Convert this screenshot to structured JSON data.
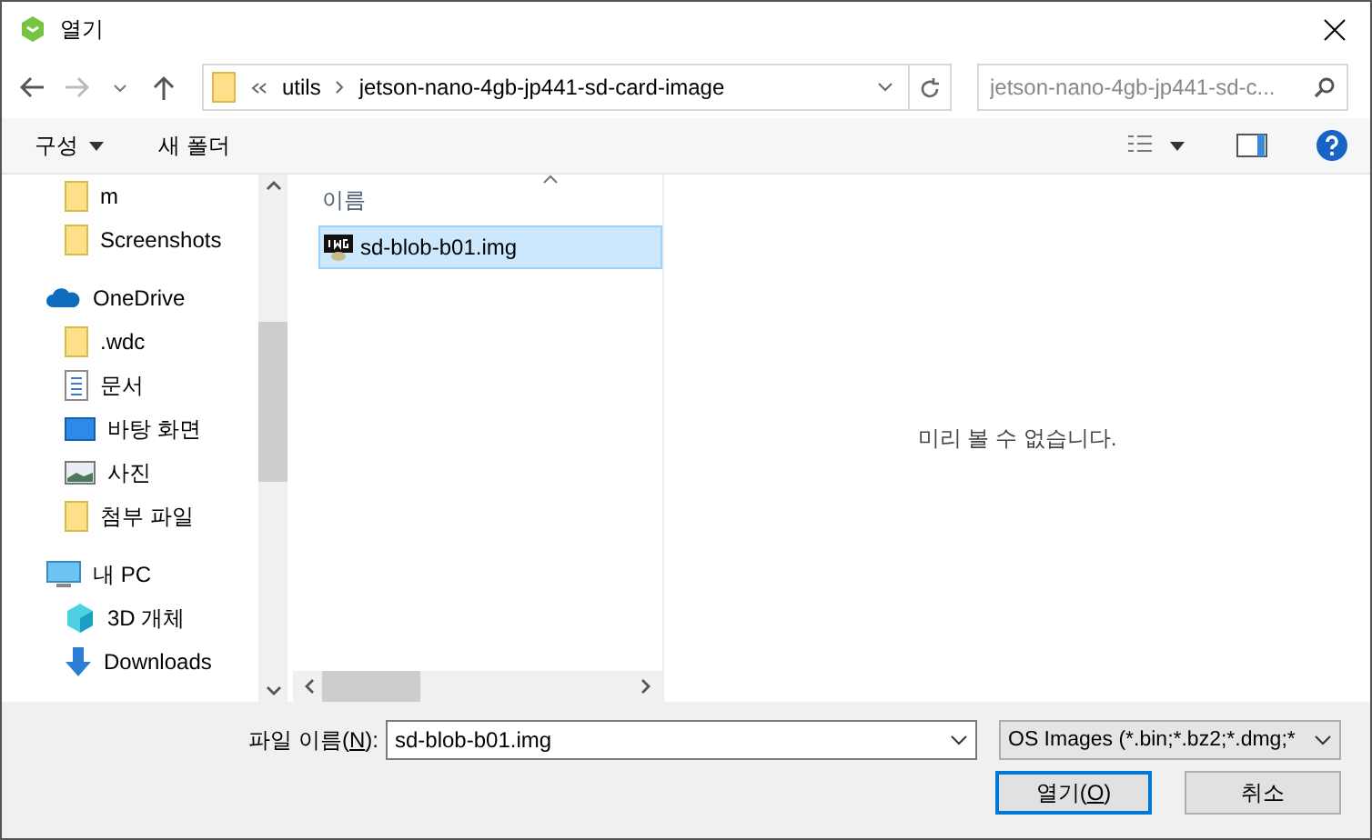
{
  "window": {
    "title": "열기"
  },
  "nav": {
    "path": [
      "utils",
      "jetson-nano-4gb-jp441-sd-card-image"
    ],
    "search_placeholder": "jetson-nano-4gb-jp441-sd-c..."
  },
  "toolbar": {
    "organize": "구성",
    "new_folder": "새 폴더"
  },
  "sidebar": [
    {
      "children": [
        {
          "kind": "folder",
          "label": "m"
        },
        {
          "kind": "folder",
          "label": "Screenshots"
        }
      ]
    },
    {
      "kind": "cloud",
      "label": "OneDrive",
      "children": [
        {
          "kind": "folder",
          "label": ".wdc"
        },
        {
          "kind": "doc",
          "label": "문서"
        },
        {
          "kind": "desktop",
          "label": "바탕 화면"
        },
        {
          "kind": "photo",
          "label": "사진"
        },
        {
          "kind": "folder",
          "label": "첨부 파일"
        }
      ]
    },
    {
      "kind": "pc",
      "label": "내 PC",
      "children": [
        {
          "kind": "cube",
          "label": "3D 개체"
        },
        {
          "kind": "download",
          "label": "Downloads"
        }
      ]
    }
  ],
  "file_list": {
    "columns": [
      "이름"
    ],
    "rows": [
      {
        "name": "sd-blob-b01.img",
        "selected": true
      }
    ]
  },
  "preview": {
    "message": "미리 볼 수 없습니다."
  },
  "footer": {
    "filename_label": {
      "before": "파일 이름(",
      "mnemonic": "N",
      "after": "):"
    },
    "filename": "sd-blob-b01.img",
    "filter": "OS Images (*.bin;*.bz2;*.dmg;*",
    "open_button": {
      "before": "열기(",
      "mnemonic": "O",
      "after": ")"
    },
    "cancel_button": "취소"
  }
}
